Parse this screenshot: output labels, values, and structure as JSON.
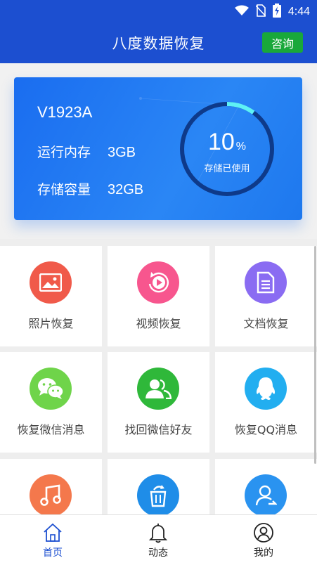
{
  "status": {
    "time": "4:44"
  },
  "appbar": {
    "title": "八度数据恢复",
    "consult_label": "咨询"
  },
  "device": {
    "model": "V1923A",
    "ram_label": "运行内存",
    "ram_value": "3GB",
    "storage_label": "存储容量",
    "storage_value": "32GB",
    "used_percent": 10,
    "used_percent_text": "10",
    "used_unit": "%",
    "used_label": "存储已使用"
  },
  "features": [
    {
      "label": "照片恢复",
      "color": "#f05a4a",
      "icon": "photo-icon"
    },
    {
      "label": "视频恢复",
      "color": "#f7568e",
      "icon": "video-play-icon"
    },
    {
      "label": "文档恢复",
      "color": "#8a6cf2",
      "icon": "document-icon"
    },
    {
      "label": "恢复微信消息",
      "color": "#6fd44a",
      "icon": "wechat-icon"
    },
    {
      "label": "找回微信好友",
      "color": "#2fb83a",
      "icon": "contacts-icon"
    },
    {
      "label": "恢复QQ消息",
      "color": "#22aef0",
      "icon": "qq-icon"
    },
    {
      "label": "",
      "color": "#f4784c",
      "icon": "music-icon"
    },
    {
      "label": "",
      "color": "#1f8de8",
      "icon": "trash-restore-icon"
    },
    {
      "label": "",
      "color": "#2a93f0",
      "icon": "user-icon"
    }
  ],
  "tabs": [
    {
      "label": "首页",
      "icon": "home-icon",
      "active": true,
      "color": "#1c4fd0"
    },
    {
      "label": "动态",
      "icon": "bell-icon",
      "active": false,
      "color": "#222222"
    },
    {
      "label": "我的",
      "icon": "profile-icon",
      "active": false,
      "color": "#222222"
    }
  ],
  "colors": {
    "primary": "#1c4fd0",
    "consult": "#19a83a",
    "ring_track": "#0e3a8a",
    "ring_progress": "#5ef2f5"
  }
}
